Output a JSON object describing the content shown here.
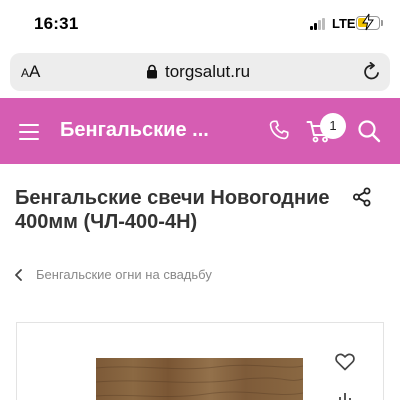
{
  "status_bar": {
    "time": "16:31",
    "network": "LTE",
    "battery_level": 0.55,
    "charging": true
  },
  "browser": {
    "text_size_button": "AA",
    "url": "torgsalut.ru"
  },
  "site_header": {
    "background_color": "#d65db3",
    "title": "Бенгальские ...",
    "cart_count": "1",
    "icons": [
      "menu-icon",
      "phone-icon",
      "cart-icon",
      "search-icon"
    ]
  },
  "product": {
    "title": "Бенгальские свечи Новогодние 400мм (ЧЛ-400-4Н)",
    "breadcrumb": "Бенгальские огни на свадьбу"
  }
}
